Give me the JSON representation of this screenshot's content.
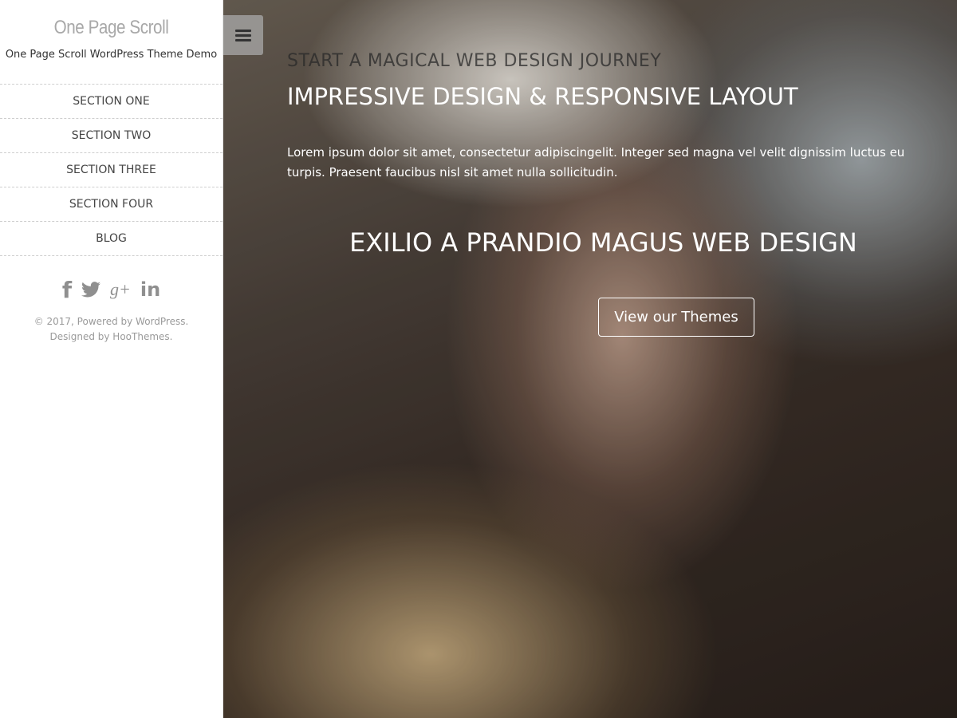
{
  "sidebar": {
    "site_title": "One Page Scroll",
    "tagline": "One Page Scroll WordPress Theme Demo",
    "menu": [
      {
        "label": "SECTION ONE"
      },
      {
        "label": "SECTION TWO"
      },
      {
        "label": "SECTION THREE"
      },
      {
        "label": "SECTION FOUR"
      },
      {
        "label": "BLOG"
      }
    ],
    "social_icons": [
      "facebook-icon",
      "twitter-icon",
      "google-plus-icon",
      "linkedin-icon"
    ],
    "social_glyphs": {
      "facebook": "f",
      "google_plus": "g+",
      "linkedin": "in"
    },
    "footer_text": "© 2017, Powered by WordPress. Designed by HooThemes."
  },
  "hero": {
    "toggle_icon": "hamburger-menu-icon",
    "kicker": "START A MAGICAL WEB DESIGN JOURNEY",
    "headline": "IMPRESSIVE DESIGN & RESPONSIVE LAYOUT",
    "lead": "Lorem ipsum dolor sit amet, consectetur adipiscingelit. Integer sed magna vel velit dignissim luctus eu turpis. Praesent faucibus nisl sit amet nulla sollicitudin.",
    "big_heading": "EXILIO A PRANDIO MAGUS WEB DESIGN",
    "cta_label": "View our Themes"
  },
  "colors": {
    "sidebar_bg": "#ffffff",
    "site_title": "#a8a8a8",
    "menu_text": "#444444",
    "icon_gray": "#8f8f8f",
    "hero_text": "#ffffff"
  }
}
